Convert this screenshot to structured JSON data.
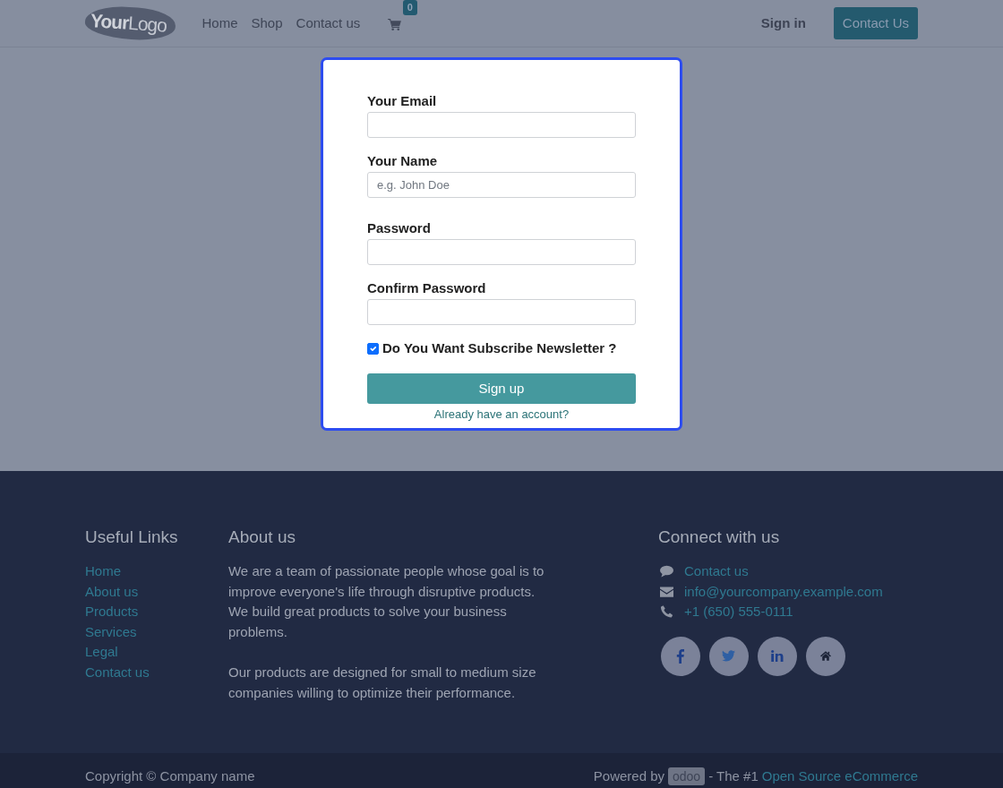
{
  "header": {
    "logo": "**Your**Logo",
    "nav": [
      {
        "label": "Home"
      },
      {
        "label": "Shop"
      },
      {
        "label": "Contact us"
      }
    ],
    "cart": {
      "count": "0"
    },
    "sign_in": "Sign in",
    "contact_button": "Contact Us"
  },
  "signup_form": {
    "fields": [
      {
        "label": "Your Email"
      },
      {
        "label": "Your Name",
        "placeholder": "e.g. John Doe"
      },
      {
        "label": "Password"
      },
      {
        "label": "Confirm Password"
      }
    ],
    "newsletter": {
      "label": "Do You Want Subscribe Newsletter ?",
      "checked": true
    },
    "submit": "Sign up",
    "login_link": "Already have an account?"
  },
  "footer": {
    "useful_links": {
      "title": "Useful Links",
      "links": [
        "Home",
        "About us",
        "Products",
        "Services",
        "Legal",
        "Contact us"
      ]
    },
    "about": {
      "title": "About us",
      "paragraphs": [
        "We are a team of passionate people whose goal is to improve everyone's life through disruptive products. We build great products to solve your business problems.",
        "Our products are designed for small to medium size companies willing to optimize their performance."
      ]
    },
    "connect": {
      "title": "Connect with us",
      "items": [
        {
          "kind": "chat",
          "text": "Contact us"
        },
        {
          "kind": "mail",
          "text": "info@yourcompany.example.com"
        },
        {
          "kind": "phone",
          "text": "+1 (650) 555-0111"
        }
      ],
      "social": [
        {
          "kind": "facebook"
        },
        {
          "kind": "twitter"
        },
        {
          "kind": "linkedin"
        },
        {
          "kind": "home"
        }
      ]
    }
  },
  "copyright": {
    "text": "Copyright © Company name",
    "powered_by": "Powered by",
    "brand": "odoo",
    "tagline": "- The #1",
    "link": "Open Source eCommerce"
  }
}
